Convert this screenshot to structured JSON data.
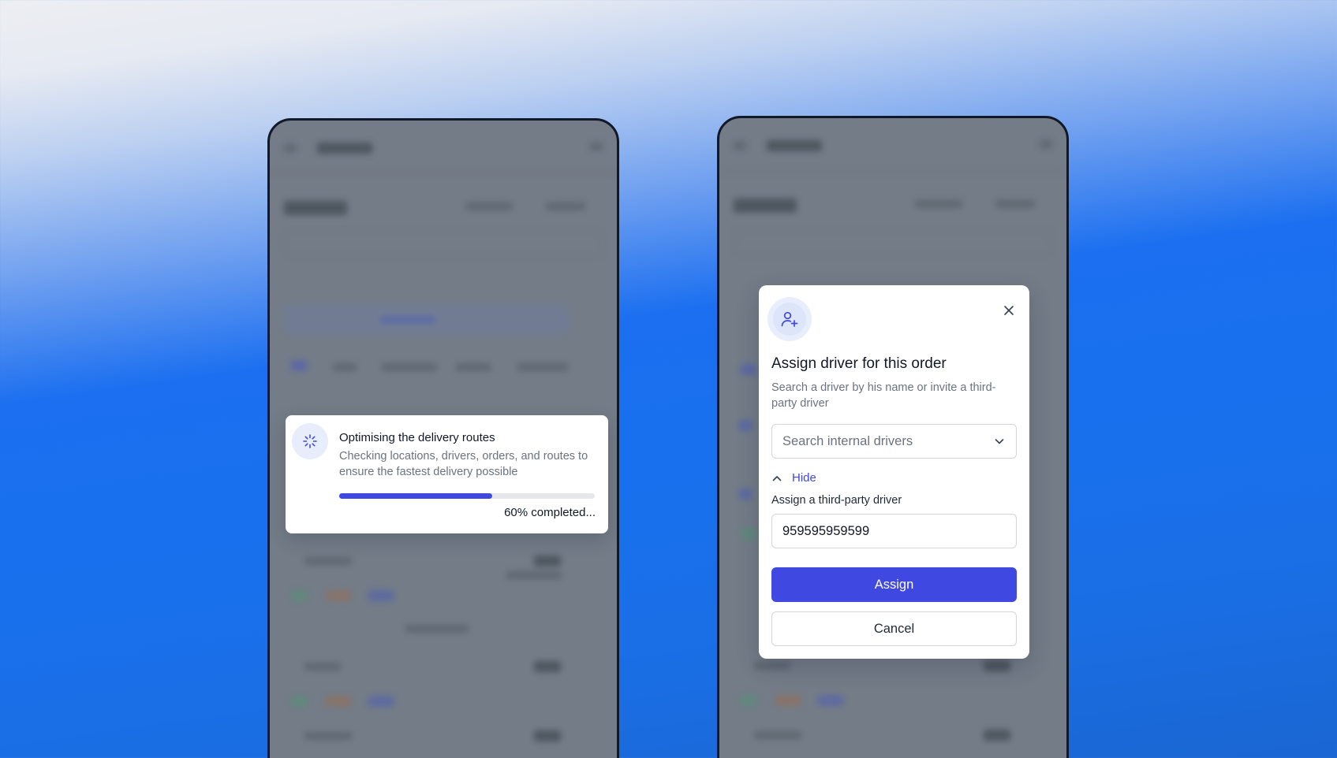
{
  "colors": {
    "accent": "#4048e2",
    "overlay": "#737c87",
    "progress_track": "#e5e7eb"
  },
  "loading_toast": {
    "icon": "spinner-icon",
    "title": "Optimising the delivery routes",
    "description": "Checking locations, drivers, orders, and routes to ensure the fastest delivery possible",
    "progress_percent": 60,
    "progress_label": "60% completed..."
  },
  "assign_modal": {
    "icon": "user-plus-icon",
    "close_icon": "close-icon",
    "title": "Assign driver for this order",
    "description": "Search a driver by his name or invite a third-party driver",
    "search": {
      "placeholder": "Search internal drivers",
      "icon": "chevron-down-icon"
    },
    "toggle": {
      "icon": "chevron-up-icon",
      "label": "Hide"
    },
    "third_party": {
      "label": "Assign a third-party driver",
      "value": "959595959599"
    },
    "assign_button": "Assign",
    "cancel_button": "Cancel"
  }
}
